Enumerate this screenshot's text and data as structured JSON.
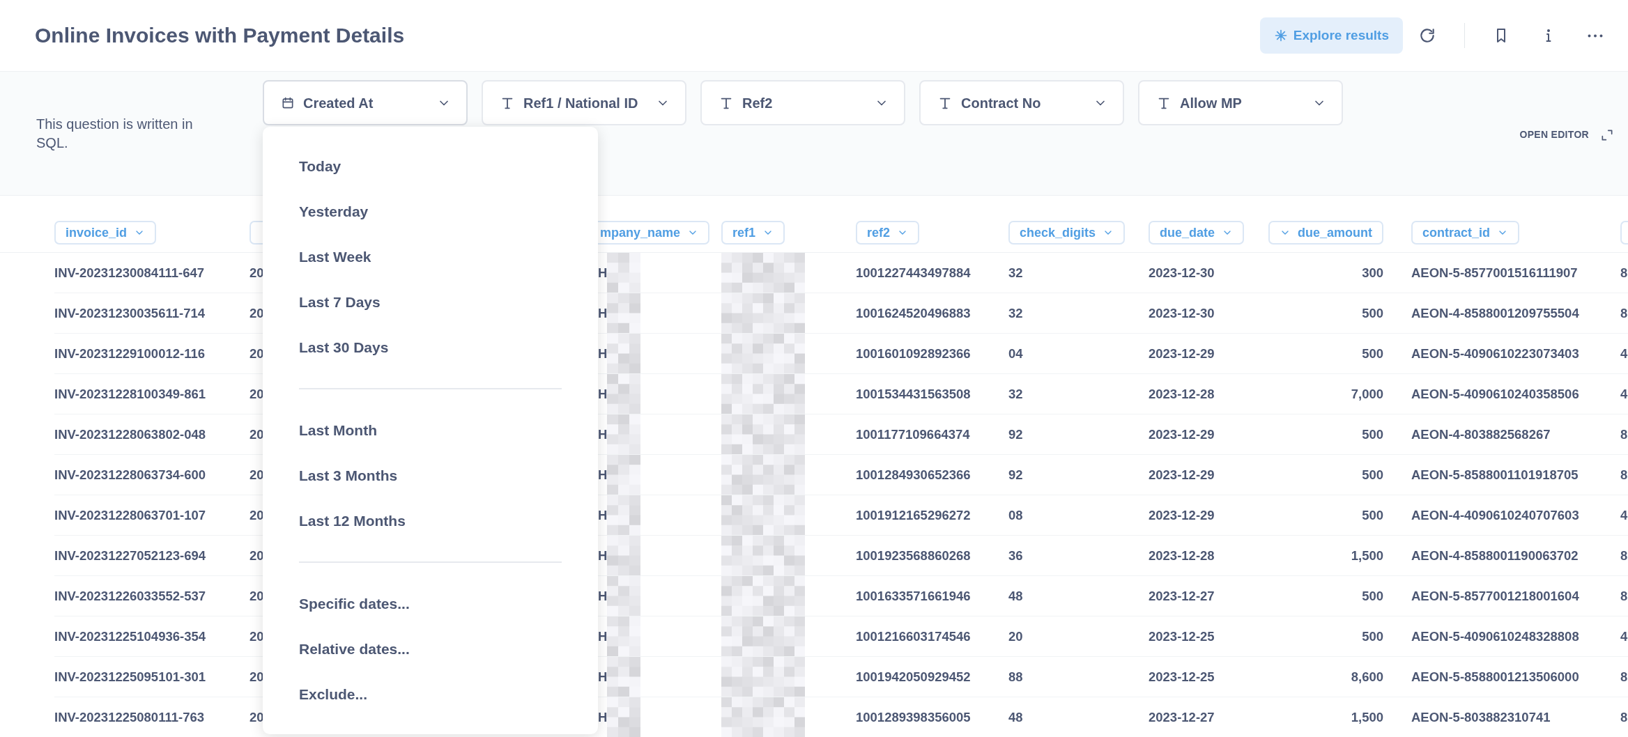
{
  "title": "Online Invoices with Payment Details",
  "toolbar": {
    "explore_label": "Explore results"
  },
  "sql_note": "This question is written in SQL.",
  "filters": [
    {
      "label": "Created At",
      "kind": "date",
      "open": true
    },
    {
      "label": "Ref1 / National ID",
      "kind": "text",
      "open": false
    },
    {
      "label": "Ref2",
      "kind": "text",
      "open": false
    },
    {
      "label": "Contract No",
      "kind": "text",
      "open": false
    },
    {
      "label": "Allow MP",
      "kind": "text",
      "open": false
    }
  ],
  "open_editor": "OPEN EDITOR",
  "date_menu": {
    "groups": [
      [
        {
          "label": "Today"
        },
        {
          "label": "Yesterday"
        },
        {
          "label": "Last Week"
        },
        {
          "label": "Last 7 Days"
        },
        {
          "label": "Last 30 Days"
        }
      ],
      [
        {
          "label": "Last Month"
        },
        {
          "label": "Last 3 Months"
        },
        {
          "label": "Last 12 Months"
        }
      ],
      [
        {
          "label": "Specific dates..."
        },
        {
          "label": "Relative dates..."
        },
        {
          "label": "Exclude..."
        }
      ]
    ]
  },
  "table": {
    "columns": [
      {
        "label": "invoice_id",
        "kind": "text"
      },
      {
        "kind": "hidden"
      },
      {
        "label": "mpany_name",
        "kind": "partly_redacted"
      },
      {
        "label": "ref1",
        "kind": "redacted"
      },
      {
        "label": "ref2",
        "kind": "text"
      },
      {
        "label": "check_digits",
        "kind": "text"
      },
      {
        "label": "due_date",
        "kind": "text"
      },
      {
        "label": "due_amount",
        "kind": "number"
      },
      {
        "label": "contract_id",
        "kind": "text"
      },
      {
        "kind": "cut"
      }
    ],
    "rows": [
      [
        "INV-20231230084111-647",
        "20",
        "H",
        null,
        "1001227443497884",
        "32",
        "2023-12-30",
        "300",
        "AEON-5-8577001516111907",
        "8"
      ],
      [
        "INV-20231230035611-714",
        "20",
        "H",
        null,
        "1001624520496883",
        "32",
        "2023-12-30",
        "500",
        "AEON-4-8588001209755504",
        "8"
      ],
      [
        "INV-20231229100012-116",
        "20",
        "H",
        null,
        "1001601092892366",
        "04",
        "2023-12-29",
        "500",
        "AEON-5-4090610223073403",
        "4"
      ],
      [
        "INV-20231228100349-861",
        "20",
        "H",
        null,
        "1001534431563508",
        "32",
        "2023-12-28",
        "7,000",
        "AEON-5-4090610240358506",
        "4"
      ],
      [
        "INV-20231228063802-048",
        "20",
        "H",
        null,
        "1001177109664374",
        "92",
        "2023-12-29",
        "500",
        "AEON-4-803882568267",
        "8"
      ],
      [
        "INV-20231228063734-600",
        "20",
        "H",
        null,
        "1001284930652366",
        "92",
        "2023-12-29",
        "500",
        "AEON-5-8588001101918705",
        "8"
      ],
      [
        "INV-20231228063701-107",
        "20",
        "H",
        null,
        "1001912165296272",
        "08",
        "2023-12-29",
        "500",
        "AEON-4-4090610240707603",
        "4"
      ],
      [
        "INV-20231227052123-694",
        "20",
        "H",
        null,
        "1001923568860268",
        "36",
        "2023-12-28",
        "1,500",
        "AEON-4-8588001190063702",
        "8"
      ],
      [
        "INV-20231226033552-537",
        "20",
        "H",
        null,
        "1001633571661946",
        "48",
        "2023-12-27",
        "500",
        "AEON-5-8577001218001604",
        "8"
      ],
      [
        "INV-20231225104936-354",
        "20",
        "H",
        null,
        "1001216603174546",
        "20",
        "2023-12-25",
        "500",
        "AEON-5-4090610248328808",
        "4"
      ],
      [
        "INV-20231225095101-301",
        "20",
        "H",
        null,
        "1001942050929452",
        "88",
        "2023-12-25",
        "8,600",
        "AEON-5-8588001213506000",
        "8"
      ],
      [
        "INV-20231225080111-763",
        "20",
        "H",
        null,
        "1001289398356005",
        "48",
        "2023-12-27",
        "1,500",
        "AEON-5-803882310741",
        "8"
      ]
    ]
  }
}
